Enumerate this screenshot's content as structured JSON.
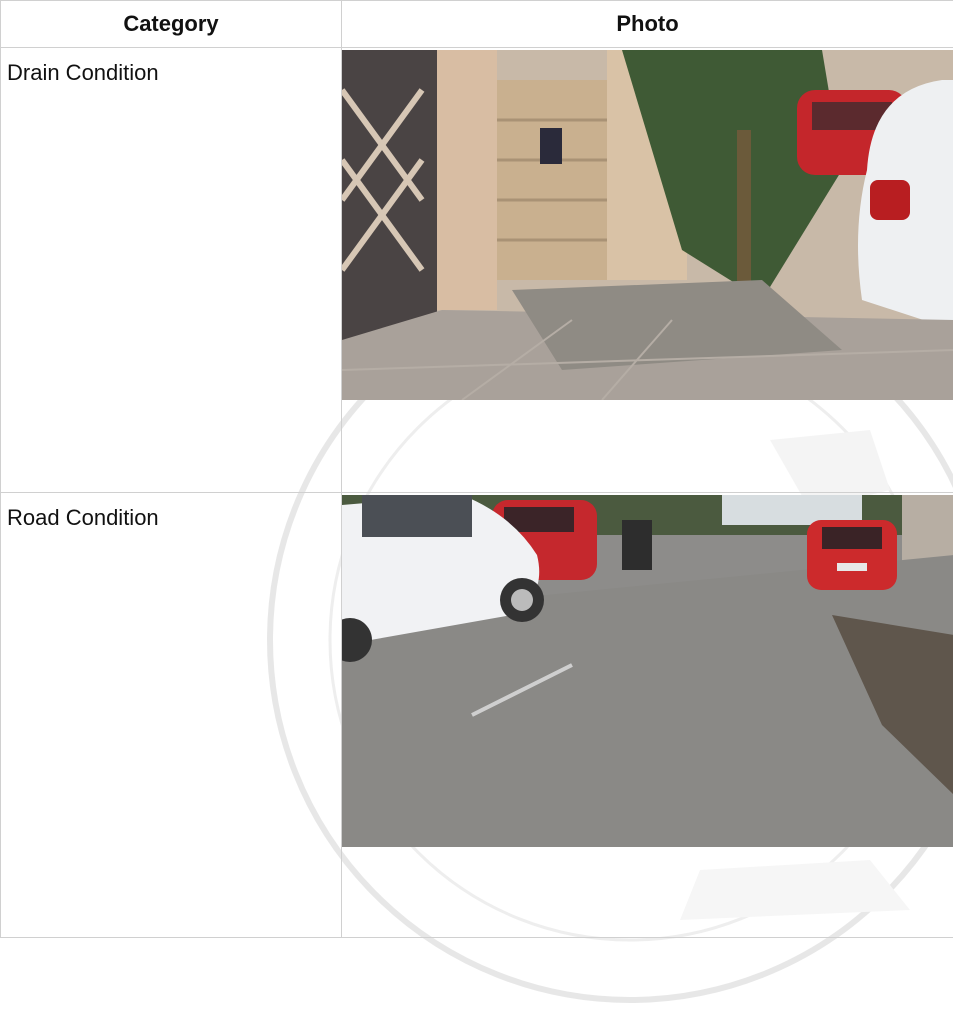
{
  "table": {
    "headers": [
      "Category",
      "Photo"
    ],
    "rows": [
      {
        "category": "Drain Condition",
        "photo_description_icon": "photo-drain"
      },
      {
        "category": "Road Condition",
        "photo_description_icon": "photo-road"
      }
    ]
  },
  "colors": {
    "border": "#d0d0d0",
    "text": "#111111"
  }
}
